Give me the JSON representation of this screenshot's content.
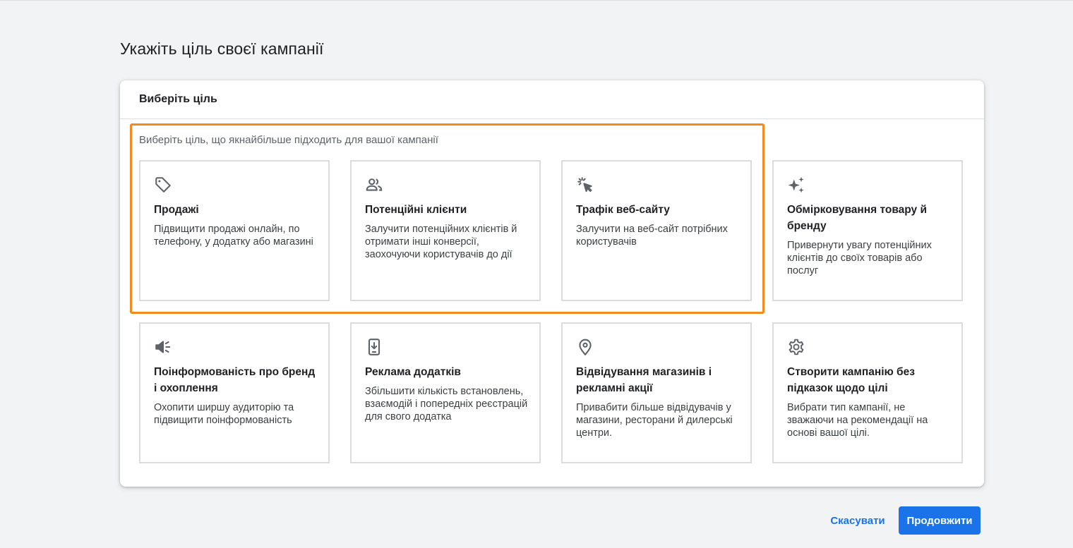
{
  "page": {
    "title": "Укажіть ціль своєї кампанії"
  },
  "card": {
    "header_title": "Виберіть ціль",
    "hint": "Виберіть ціль, що якнайбільше підходить для вашої кампанії"
  },
  "goals": [
    {
      "icon": "tag-icon",
      "title": "Продажі",
      "description": "Підвищити продажі онлайн, по телефону, у додатку або магазині"
    },
    {
      "icon": "people-icon",
      "title": "Потенційні клієнти",
      "description": "Залучити потенційних клієнтів й отримати інші конверсії, заохочуючи користувачів до дії"
    },
    {
      "icon": "cursor-click-icon",
      "title": "Трафік веб-сайту",
      "description": "Залучити на веб-сайт потрібних користувачів"
    },
    {
      "icon": "sparkle-icon",
      "title": "Обмірковування товару й бренду",
      "description": "Привернути увагу потенційних клієнтів до своїх товарів або послуг"
    },
    {
      "icon": "megaphone-icon",
      "title": "Поінформованість про бренд і охоплення",
      "description": "Охопити ширшу аудиторію та підвищити поінформованість"
    },
    {
      "icon": "phone-download-icon",
      "title": "Реклама додатків",
      "description": "Збільшити кількість встановлень, взаємодій і попередніх реєстрацій для свого додатка"
    },
    {
      "icon": "location-pin-icon",
      "title": "Відвідування магазинів і рекламні акції",
      "description": "Привабити більше відвідувачів у магазини, ресторани й дилерські центри."
    },
    {
      "icon": "gear-icon",
      "title": "Створити кампанію без підказок щодо цілі",
      "description": "Вибрати тип кампанії, не зважаючи на рекомендації на основі вашої цілі."
    }
  ],
  "footer": {
    "cancel_label": "Скасувати",
    "continue_label": "Продовжити"
  },
  "colors": {
    "accent": "#1a73e8",
    "highlight": "#f28b1c",
    "background": "#f1f3f4"
  }
}
